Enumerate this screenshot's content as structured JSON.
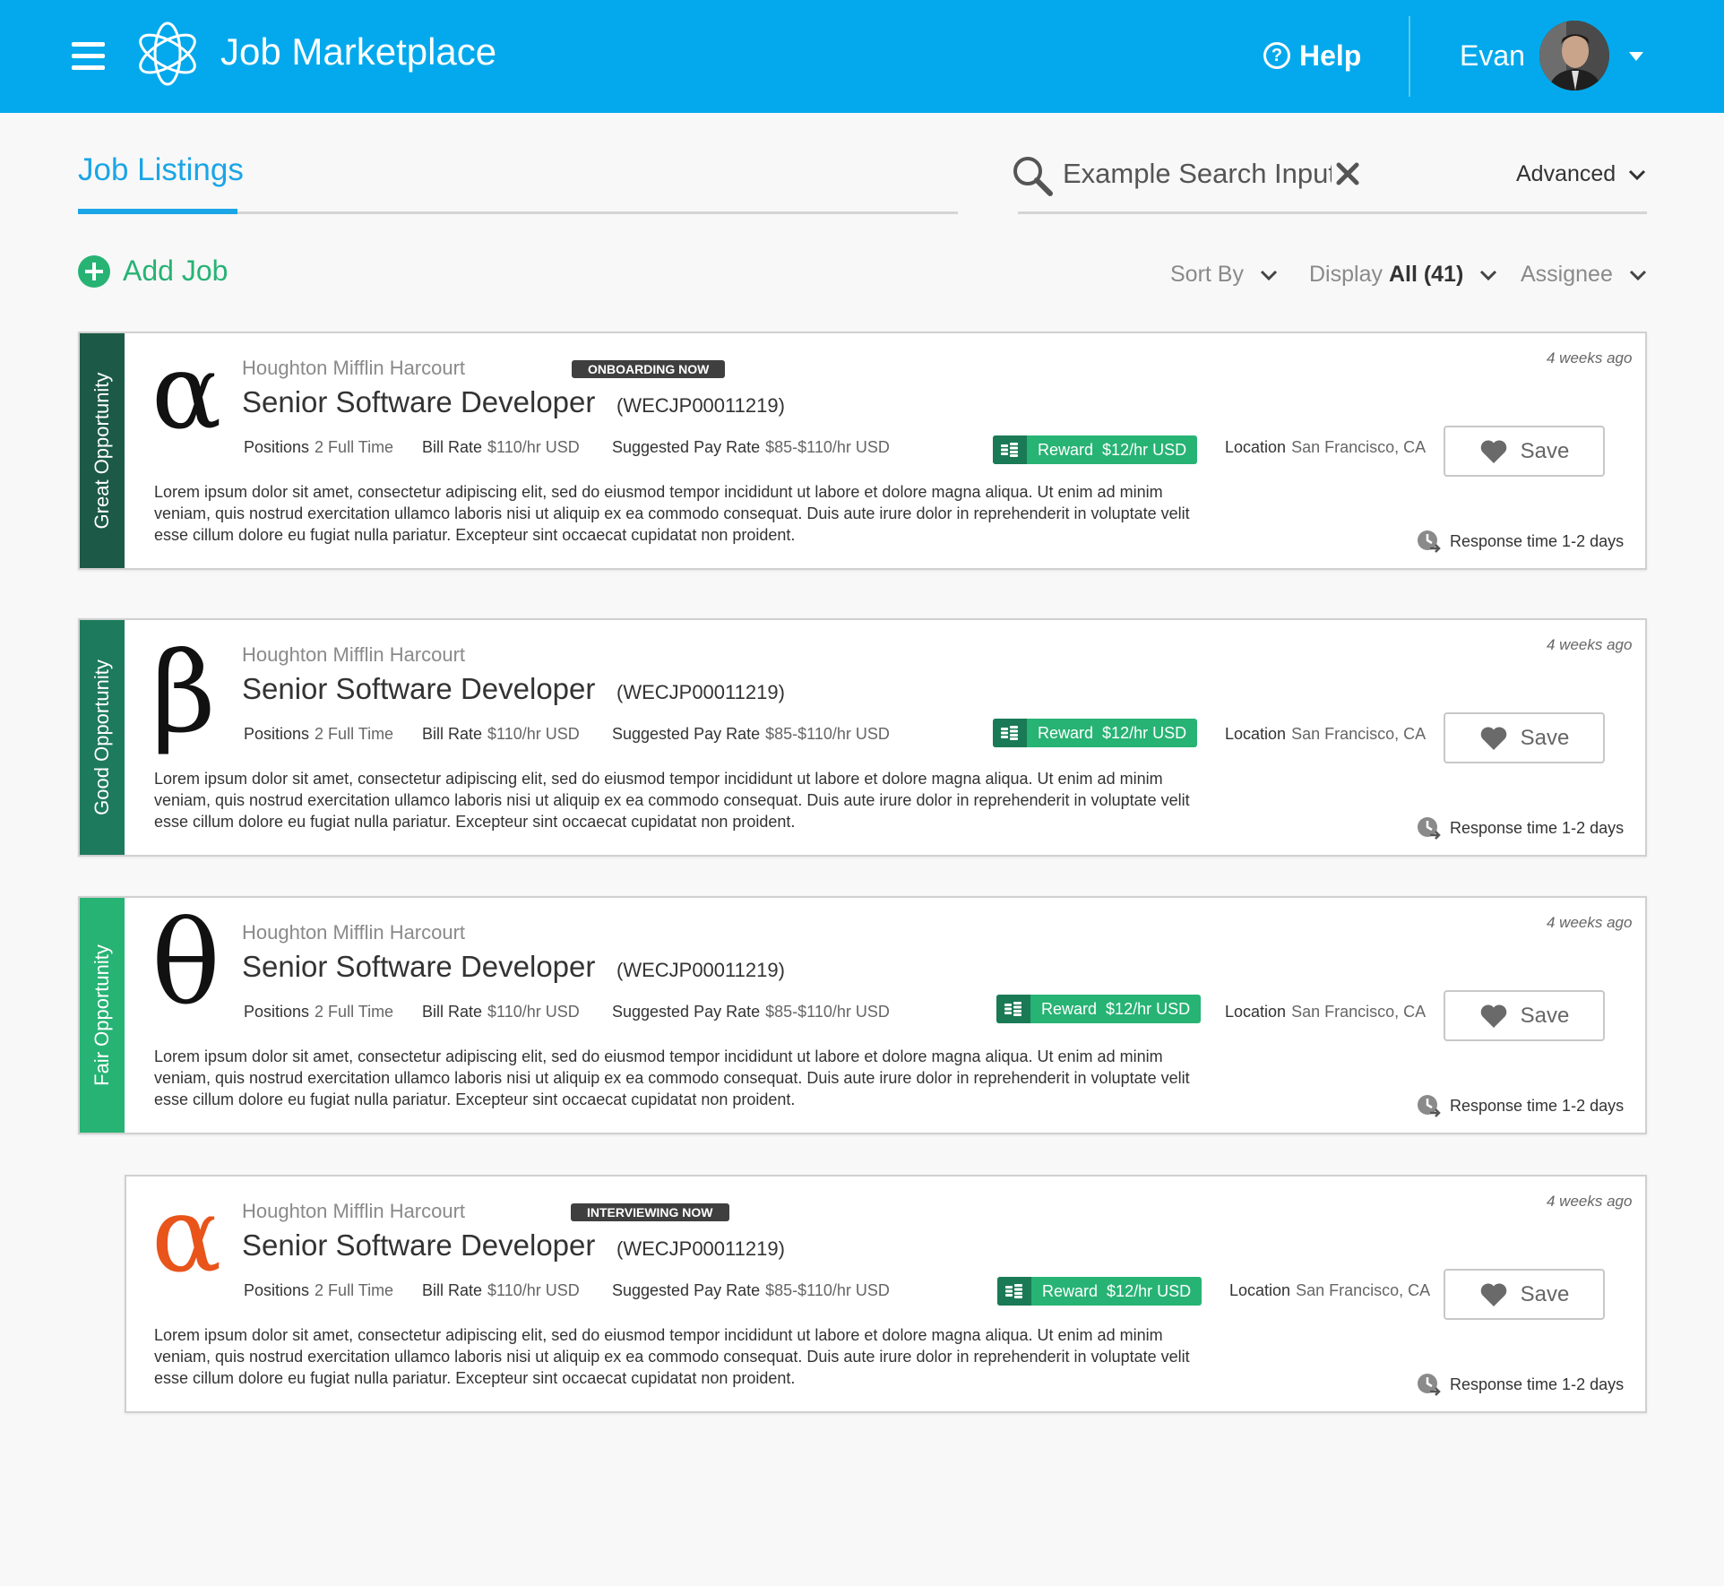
{
  "header": {
    "app_title": "Job Marketplace",
    "help_label": "Help",
    "user_name": "Evan",
    "brand_color": "#03a9ec"
  },
  "tabs": {
    "active_label": "Job Listings"
  },
  "search": {
    "placeholder": "Example Search Input",
    "advanced_label": "Advanced"
  },
  "toolbar": {
    "add_job_label": "Add Job",
    "sort_by_label": "Sort By",
    "display_label": "Display",
    "display_value": "All (41)",
    "assignee_label": "Assignee"
  },
  "labels": {
    "positions": "Positions",
    "bill_rate": "Bill Rate",
    "suggested_pay_rate": "Suggested Pay Rate",
    "reward": "Reward",
    "location": "Location",
    "save": "Save",
    "response_time": "Response time 1-2 days"
  },
  "jobs": [
    {
      "ribbon": "Great Opportunity",
      "ribbon_color": "#1c5a47",
      "symbol": "α",
      "symbol_color": "#111111",
      "company": "Houghton Mifflin Harcourt",
      "status": "ONBOARDING NOW",
      "title": "Senior Software Developer",
      "code": "(WECJP00011219)",
      "positions": "2 Full Time",
      "bill_rate": "$110/hr USD",
      "suggested_pay_rate": "$85-$110/hr USD",
      "reward": "$12/hr USD",
      "location": "San Francisco, CA",
      "description": "Lorem ipsum dolor sit amet, consectetur adipiscing elit, sed do eiusmod tempor incididunt ut labore et dolore magna aliqua. Ut enim ad minim veniam, quis nostrud exercitation ullamco laboris nisi ut aliquip ex ea commodo consequat. Duis aute irure dolor in reprehenderit in voluptate velit esse cillum dolore eu fugiat nulla pariatur. Excepteur sint occaecat cupidatat non proident.",
      "posted": "4 weeks ago"
    },
    {
      "ribbon": "Good Opportunity",
      "ribbon_color": "#1e7a5c",
      "symbol": "β",
      "symbol_color": "#111111",
      "company": "Houghton Mifflin Harcourt",
      "status": "",
      "title": "Senior Software Developer",
      "code": "(WECJP00011219)",
      "positions": "2 Full Time",
      "bill_rate": "$110/hr USD",
      "suggested_pay_rate": "$85-$110/hr USD",
      "reward": "$12/hr USD",
      "location": "San Francisco, CA",
      "description": "Lorem ipsum dolor sit amet, consectetur adipiscing elit, sed do eiusmod tempor incididunt ut labore et dolore magna aliqua. Ut enim ad minim veniam, quis nostrud exercitation ullamco laboris nisi ut aliquip ex ea commodo consequat. Duis aute irure dolor in reprehenderit in voluptate velit esse cillum dolore eu fugiat nulla pariatur. Excepteur sint occaecat cupidatat non proident.",
      "posted": "4 weeks ago"
    },
    {
      "ribbon": "Fair Opportunity",
      "ribbon_color": "#27b374",
      "symbol": "θ",
      "symbol_color": "#111111",
      "company": "Houghton Mifflin Harcourt",
      "status": "",
      "title": "Senior Software Developer",
      "code": "(WECJP00011219)",
      "positions": "2 Full Time",
      "bill_rate": "$110/hr USD",
      "suggested_pay_rate": "$85-$110/hr USD",
      "reward": "$12/hr USD",
      "location": "San Francisco, CA",
      "description": "Lorem ipsum dolor sit amet, consectetur adipiscing elit, sed do eiusmod tempor incididunt ut labore et dolore magna aliqua. Ut enim ad minim veniam, quis nostrud exercitation ullamco laboris nisi ut aliquip ex ea commodo consequat. Duis aute irure dolor in reprehenderit in voluptate velit esse cillum dolore eu fugiat nulla pariatur. Excepteur sint occaecat cupidatat non proident.",
      "posted": "4 weeks ago"
    },
    {
      "ribbon": "",
      "ribbon_color": "",
      "symbol": "α",
      "symbol_color": "#e8541a",
      "company": "Houghton Mifflin Harcourt",
      "status": "INTERVIEWING NOW",
      "title": "Senior Software Developer",
      "code": "(WECJP00011219)",
      "positions": "2 Full Time",
      "bill_rate": "$110/hr USD",
      "suggested_pay_rate": "$85-$110/hr USD",
      "reward": "$12/hr USD",
      "location": "San Francisco, CA",
      "description": "Lorem ipsum dolor sit amet, consectetur adipiscing elit, sed do eiusmod tempor incididunt ut labore et dolore magna aliqua. Ut enim ad minim veniam, quis nostrud exercitation ullamco laboris nisi ut aliquip ex ea commodo consequat. Duis aute irure dolor in reprehenderit in voluptate velit esse cillum dolore eu fugiat nulla pariatur. Excepteur sint occaecat cupidatat non proident.",
      "posted": "4 weeks ago"
    }
  ]
}
